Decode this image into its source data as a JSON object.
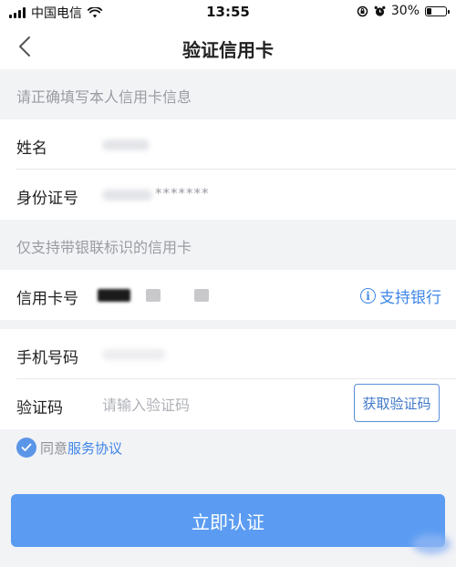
{
  "status_bar": {
    "carrier": "中国电信",
    "time": "13:55",
    "battery_percent": "30%",
    "battery_level": 0.3
  },
  "nav": {
    "title": "验证信用卡",
    "back_icon": "chevron-left-icon"
  },
  "section_personal": {
    "title": "请正确填写本人信用卡信息"
  },
  "fields": {
    "name_label": "姓名",
    "id_label": "身份证号",
    "id_value_masked": "*******",
    "card_label": "信用卡号",
    "support_bank_label": "支持银行",
    "phone_label": "手机号码",
    "code_label": "验证码",
    "code_placeholder": "请输入验证码",
    "get_code_label": "获取验证码"
  },
  "section_card": {
    "title": "仅支持带银联标识的信用卡"
  },
  "agreement": {
    "prefix": "同意",
    "link": "服务协议",
    "checked": true
  },
  "submit": {
    "label": "立即认证"
  },
  "colors": {
    "accent": "#3f86e8",
    "button": "#5b9cf2",
    "background": "#f2f3f5"
  }
}
